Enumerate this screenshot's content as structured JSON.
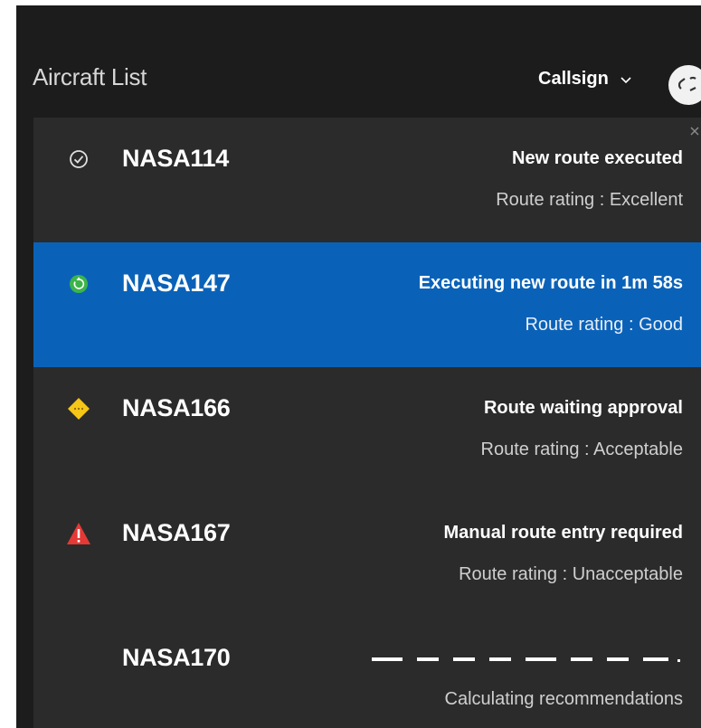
{
  "header": {
    "title": "Aircraft List",
    "sort_label": "Callsign"
  },
  "colors": {
    "background": "#2b2b2b",
    "header": "#1c1c1c",
    "selected": "#0a62b8",
    "success": "#3cb44a",
    "warning": "#f5c518",
    "error": "#e53935"
  },
  "aircraft": [
    {
      "callsign": "NASA114",
      "status": "New route executed",
      "rating": "Route rating : Excellent",
      "icon": "check-circle-icon"
    },
    {
      "callsign": "NASA147",
      "status": "Executing new route in 1m 58s",
      "rating": "Route rating : Good",
      "icon": "timer-icon"
    },
    {
      "callsign": "NASA166",
      "status": "Route waiting approval",
      "rating": "Route rating : Acceptable",
      "icon": "pending-diamond-icon"
    },
    {
      "callsign": "NASA167",
      "status": "Manual route entry required",
      "rating": "Route rating : Unacceptable",
      "icon": "warning-triangle-icon"
    },
    {
      "callsign": "NASA170",
      "status": "",
      "rating": "Calculating recommendations",
      "icon": ""
    }
  ]
}
